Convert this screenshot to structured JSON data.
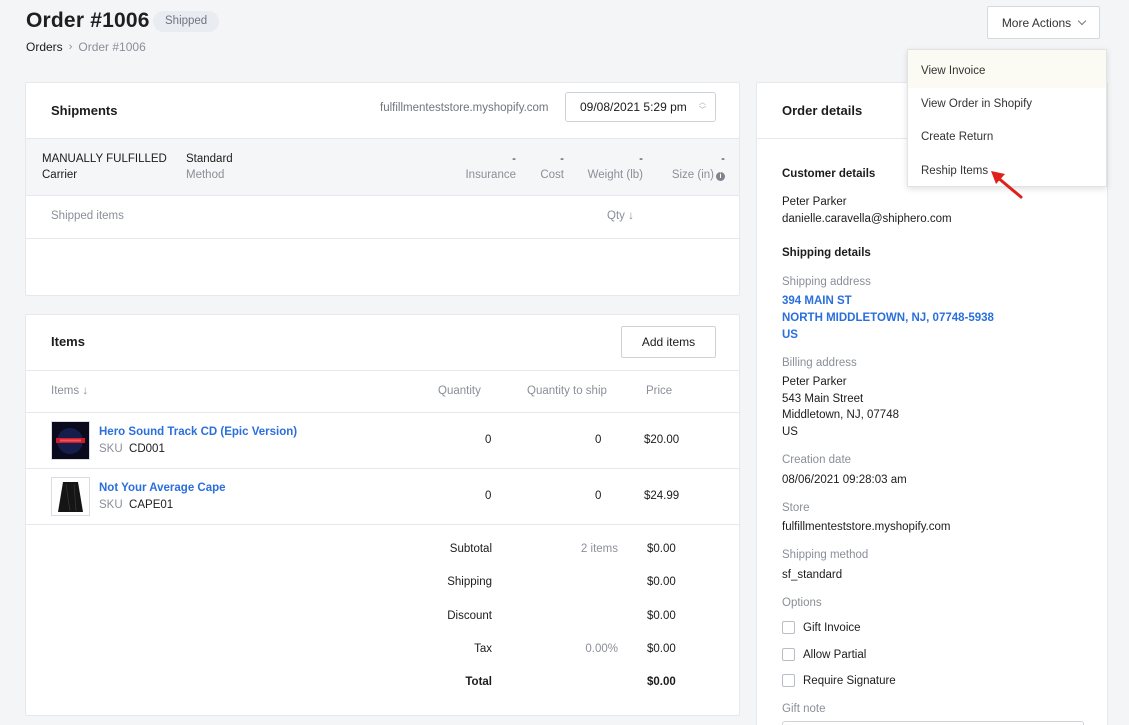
{
  "header": {
    "title": "Order #1006",
    "status": "Shipped",
    "breadcrumb": {
      "root": "Orders",
      "current": "Order #1006"
    },
    "more_actions": "More Actions"
  },
  "dropdown": {
    "items": [
      "View Invoice",
      "View Order in Shopify",
      "Create Return",
      "Reship Items"
    ]
  },
  "shipments": {
    "title": "Shipments",
    "store": "fulfillmenteststore.myshopify.com",
    "date": "09/08/2021 5:29 pm",
    "carrier_value": "MANUALLY FULFILLED",
    "carrier_label": "Carrier",
    "method_value": "Standard",
    "method_label": "Method",
    "insurance_value": "-",
    "insurance_label": "Insurance",
    "cost_value": "-",
    "cost_label": "Cost",
    "weight_value": "-",
    "weight_label": "Weight (lb)",
    "size_value": "-",
    "size_label": "Size (in)",
    "shipped_items_label": "Shipped items",
    "qty_label": "Qty"
  },
  "items": {
    "title": "Items",
    "add_button": "Add items",
    "columns": {
      "items": "Items",
      "quantity": "Quantity",
      "to_ship": "Quantity to ship",
      "price": "Price"
    },
    "rows": [
      {
        "name": "Hero Sound Track CD (Epic Version)",
        "sku_label": "SKU",
        "sku": "CD001",
        "quantity": "0",
        "to_ship": "0",
        "price": "$20.00"
      },
      {
        "name": "Not Your Average Cape",
        "sku_label": "SKU",
        "sku": "CAPE01",
        "quantity": "0",
        "to_ship": "0",
        "price": "$24.99"
      }
    ],
    "totals": {
      "subtotal_label": "Subtotal",
      "subtotal_mid": "2 items",
      "subtotal": "$0.00",
      "shipping_label": "Shipping",
      "shipping": "$0.00",
      "discount_label": "Discount",
      "discount": "$0.00",
      "tax_label": "Tax",
      "tax_mid": "0.00%",
      "tax": "$0.00",
      "total_label": "Total",
      "total": "$0.00"
    }
  },
  "details": {
    "title": "Order details",
    "customer_heading": "Customer details",
    "customer_name": "Peter Parker",
    "customer_email": "danielle.caravella@shiphero.com",
    "shipping_heading": "Shipping details",
    "shipping_address_label": "Shipping address",
    "shipping_address": [
      "394 MAIN ST",
      "NORTH MIDDLETOWN, NJ, 07748-5938",
      "US"
    ],
    "billing_address_label": "Billing address",
    "billing_address": [
      "Peter Parker",
      "543 Main Street",
      "Middletown, NJ, 07748",
      "US"
    ],
    "creation_label": "Creation date",
    "creation_date": "08/06/2021 09:28:03 am",
    "store_label": "Store",
    "store": "fulfillmenteststore.myshopify.com",
    "shipping_method_label": "Shipping method",
    "shipping_method": "sf_standard",
    "options_label": "Options",
    "options": [
      "Gift Invoice",
      "Allow Partial",
      "Require Signature"
    ],
    "gift_note_label": "Gift note"
  },
  "colors": {
    "link": "#2a6fdb",
    "muted": "#8a8f98",
    "arrow": "#e0201b"
  }
}
